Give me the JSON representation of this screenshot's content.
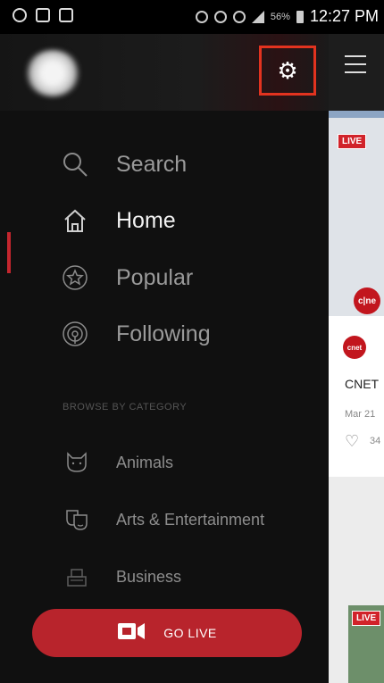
{
  "status_bar": {
    "battery": "56%",
    "time": "12:27 PM"
  },
  "drawer": {
    "settings_icon": "gear-icon",
    "nav": [
      {
        "label": "Search",
        "icon": "search-icon",
        "active": false
      },
      {
        "label": "Home",
        "icon": "home-icon",
        "active": true
      },
      {
        "label": "Popular",
        "icon": "star-icon",
        "active": false
      },
      {
        "label": "Following",
        "icon": "broadcast-icon",
        "active": false
      }
    ],
    "section_label": "BROWSE BY CATEGORY",
    "categories": [
      {
        "label": "Animals",
        "icon": "cat-icon"
      },
      {
        "label": "Arts & Entertainment",
        "icon": "theater-masks-icon"
      },
      {
        "label": "Business",
        "icon": "cash-register-icon"
      }
    ],
    "go_live_label": "GO LIVE"
  },
  "feed": {
    "live_badge": "LIVE",
    "logo_text": "c|ne",
    "small_logo_text": "cnet",
    "card_title": "CNET",
    "card_date": "Mar 21",
    "card_likes": "34",
    "live_badge_2": "LIVE"
  },
  "colors": {
    "accent": "#c4262e",
    "highlight_box": "#e2331f",
    "drawer_bg": "#101010"
  }
}
